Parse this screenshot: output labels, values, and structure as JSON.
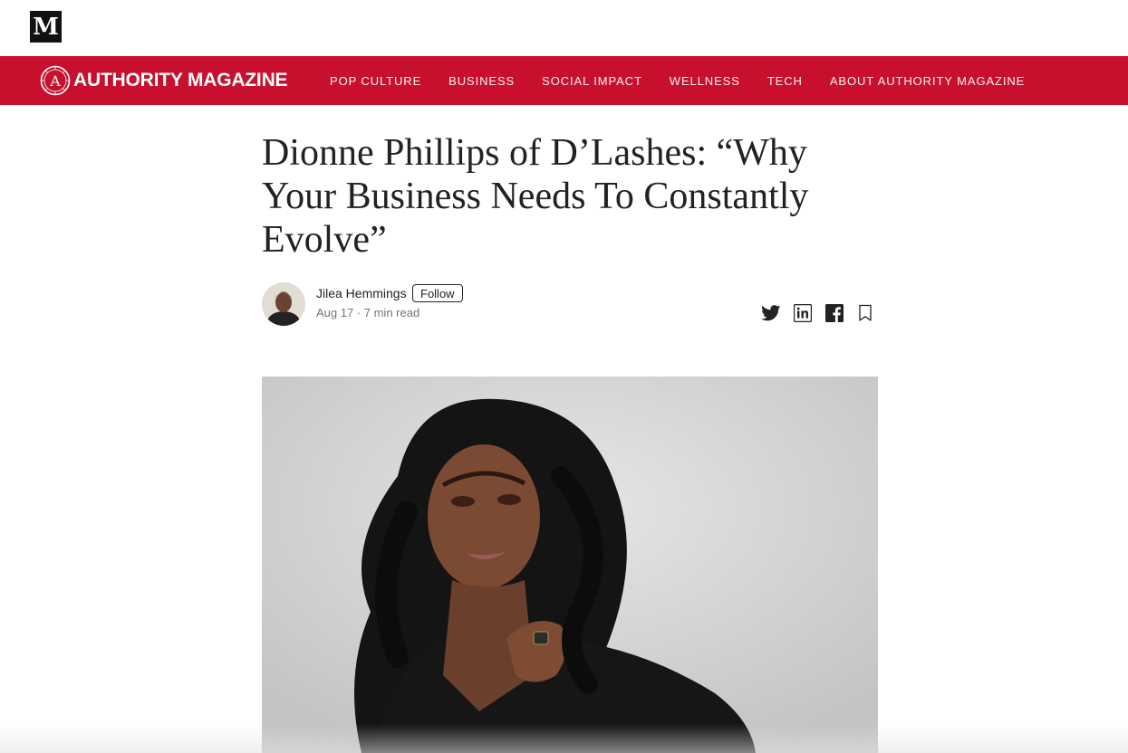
{
  "site": {
    "logo_letter": "M"
  },
  "publication": {
    "name": "AUTHORITY MAGAZINE",
    "emblem_letter": "A",
    "brand_color": "#c8102e",
    "nav": [
      "POP CULTURE",
      "BUSINESS",
      "SOCIAL IMPACT",
      "WELLNESS",
      "TECH",
      "ABOUT AUTHORITY MAGAZINE"
    ]
  },
  "article": {
    "title": "Dionne Phillips of D’Lashes: “Why Your Business Needs To Constantly Evolve”",
    "author": "Jilea Hemmings",
    "follow_label": "Follow",
    "meta": "Aug 17 · 7 min read"
  },
  "share_icons": [
    "twitter-icon",
    "linkedin-icon",
    "facebook-icon",
    "bookmark-icon"
  ]
}
